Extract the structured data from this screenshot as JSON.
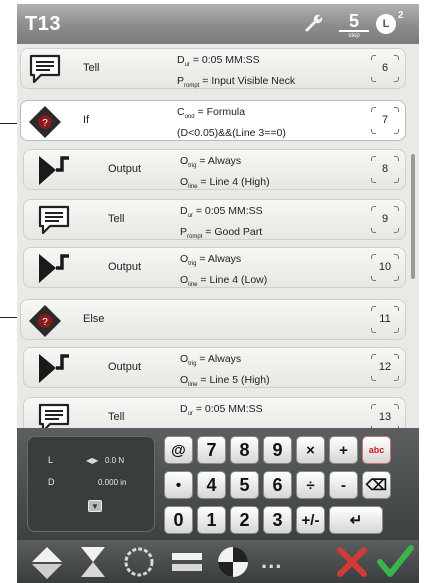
{
  "window": {
    "title": "T13",
    "step_number": "5",
    "step_sub": "step",
    "clock_badge": "2"
  },
  "steps": [
    {
      "icon": "tell-icon",
      "name": "Tell",
      "p1": {
        "sym": "D",
        "sub": "ur",
        "text": " = 0:05 MM:SS"
      },
      "p2": {
        "sym": "P",
        "sub": "rompt",
        "text": " = Input Visible Neck"
      },
      "num": "6",
      "sub": false,
      "selected": false
    },
    {
      "icon": "if-icon",
      "name": "If",
      "p1": {
        "sym": "C",
        "sub": "ond",
        "text": " = Formula"
      },
      "p2": {
        "sym": "",
        "sub": "",
        "text": "(D<0.05)&&(Line 3==0)"
      },
      "num": "7",
      "sub": false,
      "selected": true
    },
    {
      "icon": "output-icon",
      "name": "Output",
      "p1": {
        "sym": "O",
        "sub": "trig",
        "text": " = Always"
      },
      "p2": {
        "sym": "O",
        "sub": "line",
        "text": " = Line 4 (High)"
      },
      "num": "8",
      "sub": true,
      "selected": false
    },
    {
      "icon": "tell-icon",
      "name": "Tell",
      "p1": {
        "sym": "D",
        "sub": "ur",
        "text": " = 0:05 MM:SS"
      },
      "p2": {
        "sym": "P",
        "sub": "rompt",
        "text": " = Good Part"
      },
      "num": "9",
      "sub": true,
      "selected": false
    },
    {
      "icon": "output-icon",
      "name": "Output",
      "p1": {
        "sym": "O",
        "sub": "trig",
        "text": " = Always"
      },
      "p2": {
        "sym": "O",
        "sub": "line",
        "text": " = Line 4 (Low)"
      },
      "num": "10",
      "sub": true,
      "selected": false
    },
    {
      "icon": "else-icon",
      "name": "Else",
      "p1": {
        "sym": "",
        "sub": "",
        "text": ""
      },
      "p2": {
        "sym": "",
        "sub": "",
        "text": ""
      },
      "num": "11",
      "sub": false,
      "selected": false
    },
    {
      "icon": "output-icon",
      "name": "Output",
      "p1": {
        "sym": "O",
        "sub": "trig",
        "text": " = Always"
      },
      "p2": {
        "sym": "O",
        "sub": "line",
        "text": " = Line 5 (High)"
      },
      "num": "12",
      "sub": true,
      "selected": false
    },
    {
      "icon": "tell-icon",
      "name": "Tell",
      "p1": {
        "sym": "D",
        "sub": "ur",
        "text": " = 0:05 MM:SS"
      },
      "p2": {
        "sym": "",
        "sub": "",
        "text": ""
      },
      "num": "13",
      "sub": true,
      "selected": false
    }
  ],
  "readout": {
    "load_label": "L",
    "load_value": "0.0 N",
    "distance_label": "D",
    "distance_value": "0.000 in"
  },
  "keypad": {
    "row1": [
      "@",
      "7",
      "8",
      "9",
      "×",
      "+",
      "abc"
    ],
    "row2": [
      "•",
      "4",
      "5",
      "6",
      "÷",
      "-",
      "⌫"
    ],
    "row3": [
      "0",
      "1",
      "2",
      "3",
      "+/-",
      "↵"
    ]
  },
  "colors": {
    "accept": "#3bb54a",
    "cancel": "#d23a3a",
    "diamond": "#2a2a2a"
  }
}
